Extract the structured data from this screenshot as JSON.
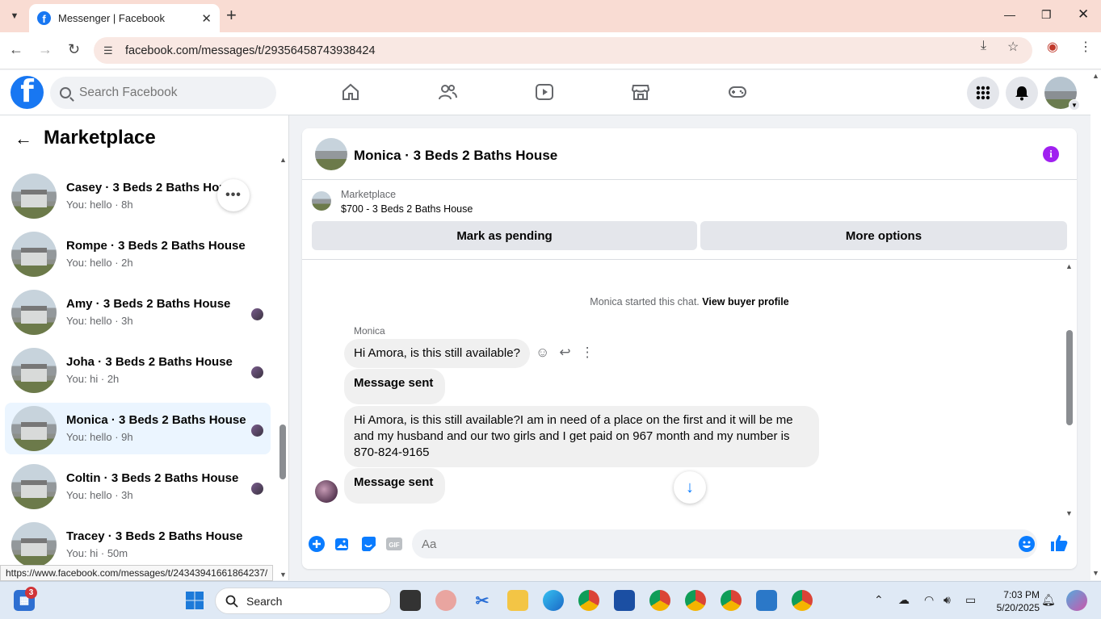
{
  "browser": {
    "tab_title": "Messenger | Facebook",
    "url": "facebook.com/messages/t/29356458743938424",
    "status_url": "https://www.facebook.com/messages/t/24343941661864237/"
  },
  "fb": {
    "search_placeholder": "Search Facebook"
  },
  "sidebar": {
    "title": "Marketplace",
    "conversations": [
      {
        "name": "Casey · 3 Beds 2 Baths House",
        "sub": "You: hello · 8h"
      },
      {
        "name": "Rompe · 3 Beds 2 Baths House",
        "sub": "You: hello · 2h"
      },
      {
        "name": "Amy · 3 Beds 2 Baths House",
        "sub": "You: hello · 3h"
      },
      {
        "name": "Joha · 3 Beds 2 Baths House",
        "sub": "You: hi · 2h"
      },
      {
        "name": "Monica · 3 Beds 2 Baths House",
        "sub": "You: hello · 9h"
      },
      {
        "name": "Coltin · 3 Beds 2 Baths House",
        "sub": "You: hello · 3h"
      },
      {
        "name": "Tracey · 3 Beds 2 Baths House",
        "sub": "You: hi · 50m"
      }
    ]
  },
  "chat": {
    "title": "Monica · 3 Beds 2 Baths House",
    "marketplace_label": "Marketplace",
    "listing": "$700 - 3 Beds 2 Baths House",
    "mark_pending": "Mark as pending",
    "more_options": "More options",
    "started_text": "Monica started this chat.",
    "view_profile": "View buyer profile",
    "sender": "Monica",
    "messages": [
      "Hi Amora, is this still available?",
      "Message sent",
      "Hi Amora, is this still available?I am in need of a place on the first and it will be me and my husband and our two girls and I get paid on 967  month and my number is 870-824-9165",
      "Message sent"
    ],
    "composer_placeholder": "Aa"
  },
  "taskbar": {
    "search_label": "Search",
    "time": "7:03 PM",
    "date": "5/20/2025",
    "badge": "3"
  },
  "colors": {
    "fb_blue": "#1877f2",
    "messenger_blue": "#0a7cff",
    "info_purple": "#a020f0",
    "active_conv": "#ebf5ff"
  }
}
